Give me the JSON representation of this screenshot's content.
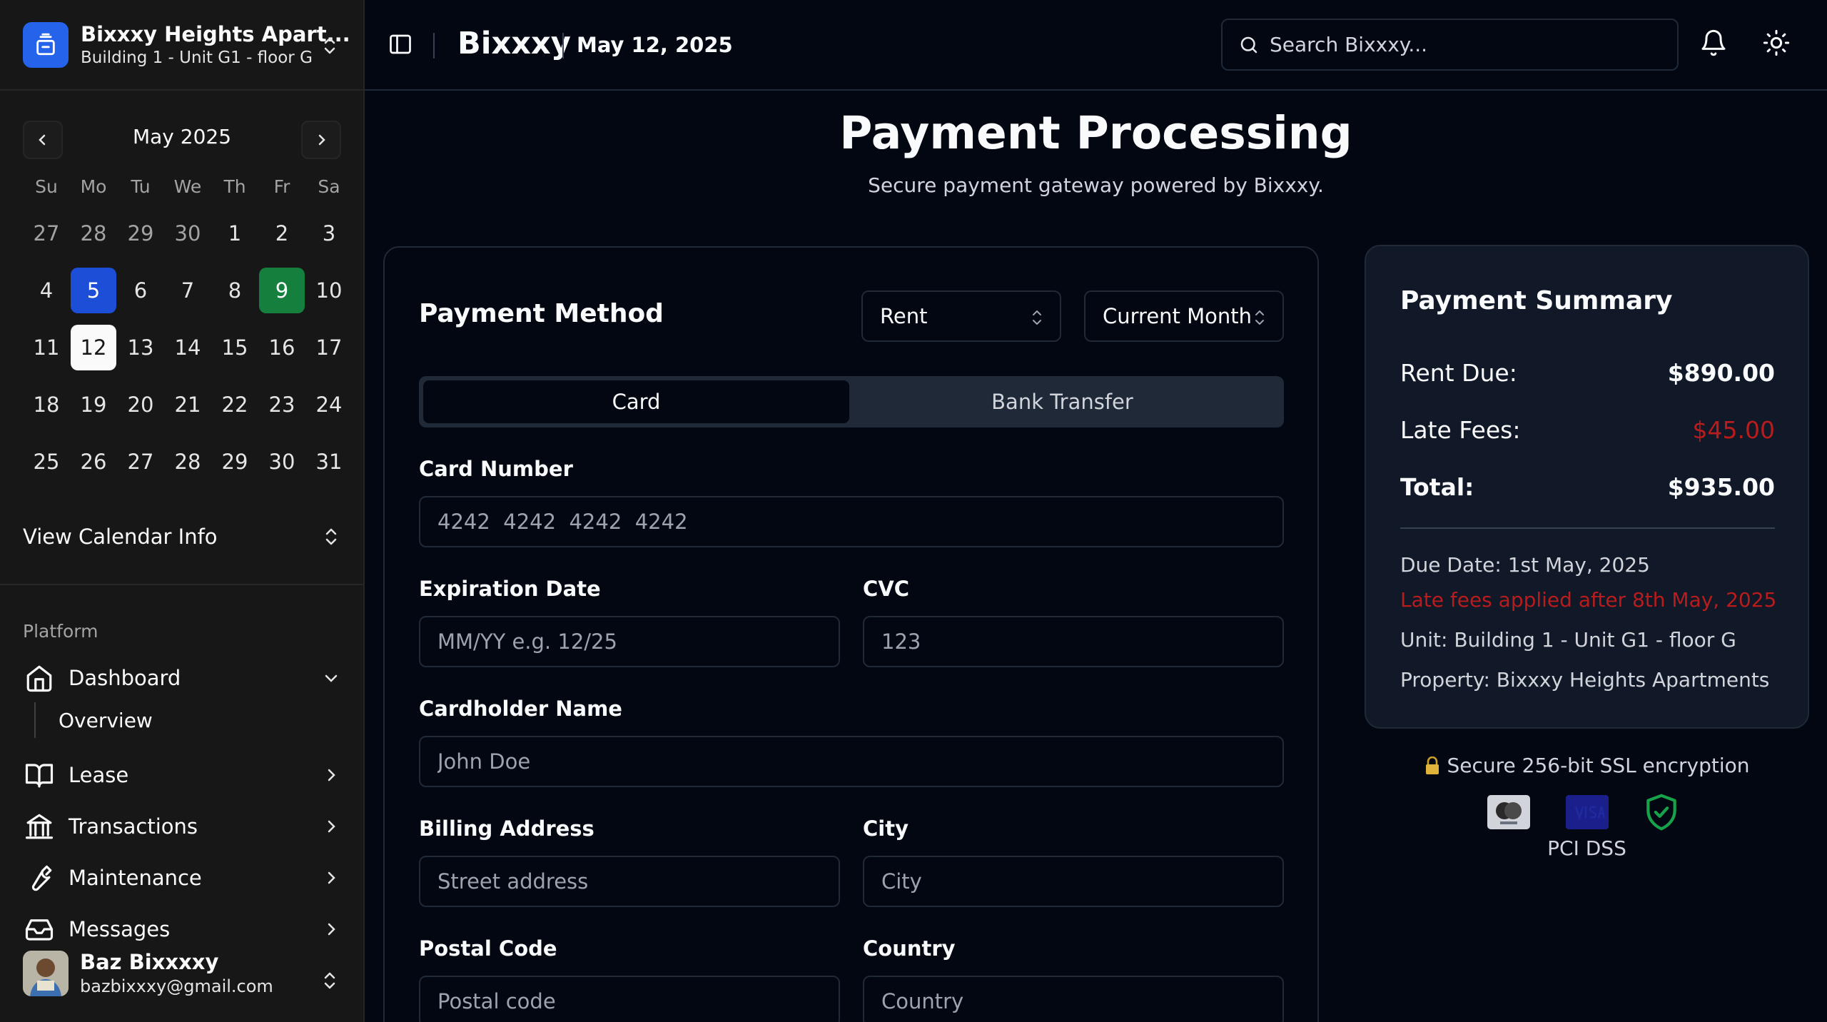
{
  "property": {
    "name": "Bixxxy Heights Apart...",
    "unit": "Building 1 - Unit G1 - floor G"
  },
  "calendar": {
    "month_label": "May 2025",
    "weekdays": [
      "Su",
      "Mo",
      "Tu",
      "We",
      "Th",
      "Fr",
      "Sa"
    ],
    "days": [
      [
        "27",
        "28",
        "29",
        "30",
        "1",
        "2",
        "3"
      ],
      [
        "4",
        "5",
        "6",
        "7",
        "8",
        "9",
        "10"
      ],
      [
        "11",
        "12",
        "13",
        "14",
        "15",
        "16",
        "17"
      ],
      [
        "18",
        "19",
        "20",
        "21",
        "22",
        "23",
        "24"
      ],
      [
        "25",
        "26",
        "27",
        "28",
        "29",
        "30",
        "31"
      ]
    ],
    "selected_blue": "5",
    "selected_green": "9",
    "today": "12",
    "info_label": "View Calendar Info"
  },
  "nav": {
    "section_label": "Platform",
    "items": [
      {
        "label": "Dashboard",
        "icon": "home-icon"
      },
      {
        "label": "Lease",
        "icon": "book-open-icon"
      },
      {
        "label": "Transactions",
        "icon": "bank-icon"
      },
      {
        "label": "Maintenance",
        "icon": "wrench-icon"
      },
      {
        "label": "Messages",
        "icon": "inbox-icon"
      }
    ],
    "sub_items": [
      {
        "label": "Overview"
      }
    ]
  },
  "user": {
    "name": "Baz Bixxxxy",
    "email": "bazbixxxy@gmail.com"
  },
  "topbar": {
    "brand": "Bixxxy",
    "date": "May 12, 2025",
    "search_placeholder": "Search Bixxxy..."
  },
  "page": {
    "title": "Payment Processing",
    "subtitle": "Secure payment gateway powered by Bixxxy."
  },
  "payment_form": {
    "title": "Payment Method",
    "type_select": "Rent",
    "period_select": "Current Month",
    "tabs": [
      "Card",
      "Bank Transfer"
    ],
    "active_tab": "Card",
    "fields": {
      "card_number": {
        "label": "Card Number",
        "placeholder": "4242  4242  4242  4242"
      },
      "expiration": {
        "label": "Expiration Date",
        "placeholder": "MM/YY e.g. 12/25"
      },
      "cvc": {
        "label": "CVC",
        "placeholder": "123"
      },
      "cardholder": {
        "label": "Cardholder Name",
        "placeholder": "John Doe"
      },
      "billing": {
        "label": "Billing Address",
        "placeholder": "Street address"
      },
      "city": {
        "label": "City",
        "placeholder": "City"
      },
      "postal": {
        "label": "Postal Code",
        "placeholder": "Postal code"
      },
      "country": {
        "label": "Country",
        "placeholder": "Country"
      }
    }
  },
  "summary": {
    "title": "Payment Summary",
    "rent_label": "Rent Due:",
    "rent_value": "$890.00",
    "late_label": "Late Fees:",
    "late_value": "$45.00",
    "total_label": "Total:",
    "total_value": "$935.00",
    "due_date": "Due Date: 1st May, 2025",
    "late_notice": "Late fees applied after 8th May, 2025",
    "unit": "Unit: Building 1 - Unit G1 - floor G",
    "property": "Property: Bixxxy Heights Apartments"
  },
  "security": {
    "ssl_text": "Secure 256-bit SSL encryption",
    "pci_text": "PCI DSS",
    "badge_icons": [
      "mastercard-icon",
      "visa-icon",
      "shield-check-icon"
    ]
  },
  "colors": {
    "accent_blue": "#1d4ed8",
    "accent_green": "#15803d",
    "late_red": "#b91c1c",
    "background": "#030712"
  }
}
